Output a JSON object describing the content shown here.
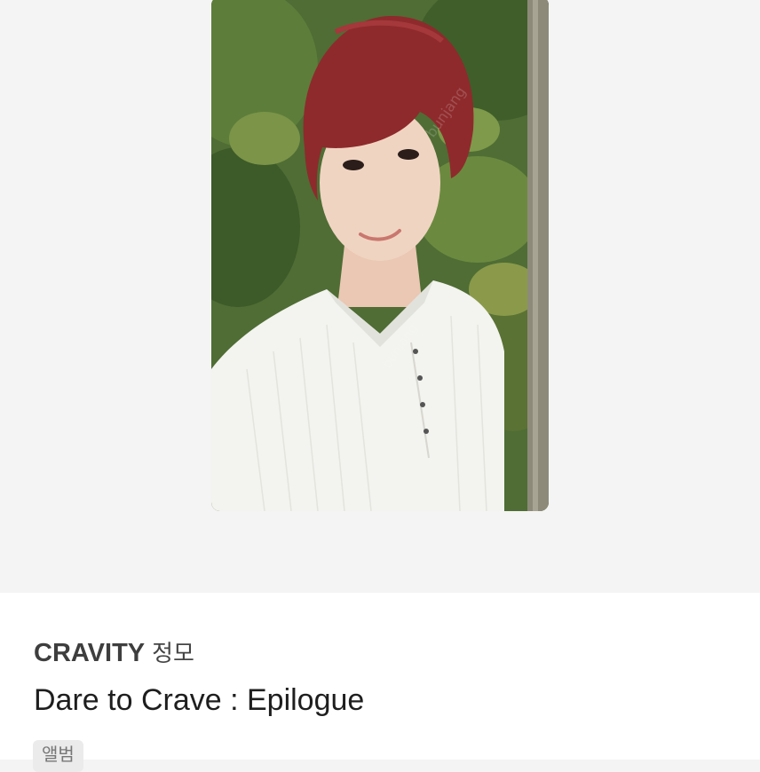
{
  "photocard": {
    "description_icon": "photocard-image"
  },
  "item": {
    "artist": "CRAVITY",
    "member": "정모",
    "album_title": "Dare to Crave : Epilogue",
    "category_tag": "앨범"
  },
  "colors": {
    "background": "#f4f4f4",
    "info_background": "#ffffff",
    "hair": "#8e2a2c",
    "foliage": "#4d6b33",
    "shirt": "#f3f3ef"
  }
}
